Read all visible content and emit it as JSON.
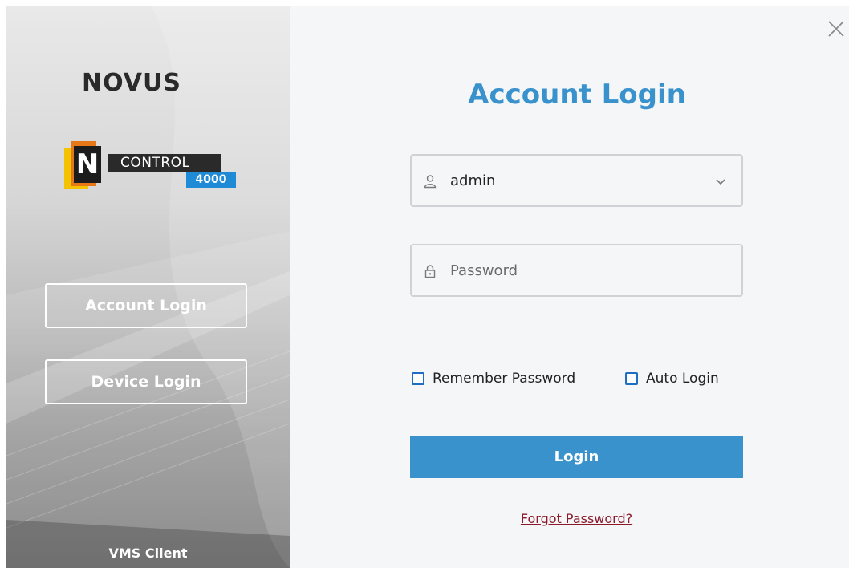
{
  "sidebar": {
    "brand": "NOVUS",
    "product_mark": "N",
    "product_name": "CONTROL",
    "product_number": "4000",
    "tabs": [
      {
        "label": "Account Login"
      },
      {
        "label": "Device Login"
      }
    ],
    "footer": "VMS Client"
  },
  "login": {
    "title": "Account Login",
    "username": {
      "value": "admin",
      "icon": "user-icon"
    },
    "password": {
      "placeholder": "Password",
      "icon": "lock-icon"
    },
    "remember_password": {
      "label": "Remember Password",
      "checked": false
    },
    "auto_login": {
      "label": "Auto Login",
      "checked": false
    },
    "submit_label": "Login",
    "forgot_label": "Forgot Password?"
  },
  "colors": {
    "accent": "#3a92cc",
    "link": "#8b1a2c",
    "checkbox_border": "#1e6fc1",
    "brand_orange": "#e67817",
    "brand_yellow": "#f3c300",
    "brand_blue": "#1f8bd6"
  }
}
